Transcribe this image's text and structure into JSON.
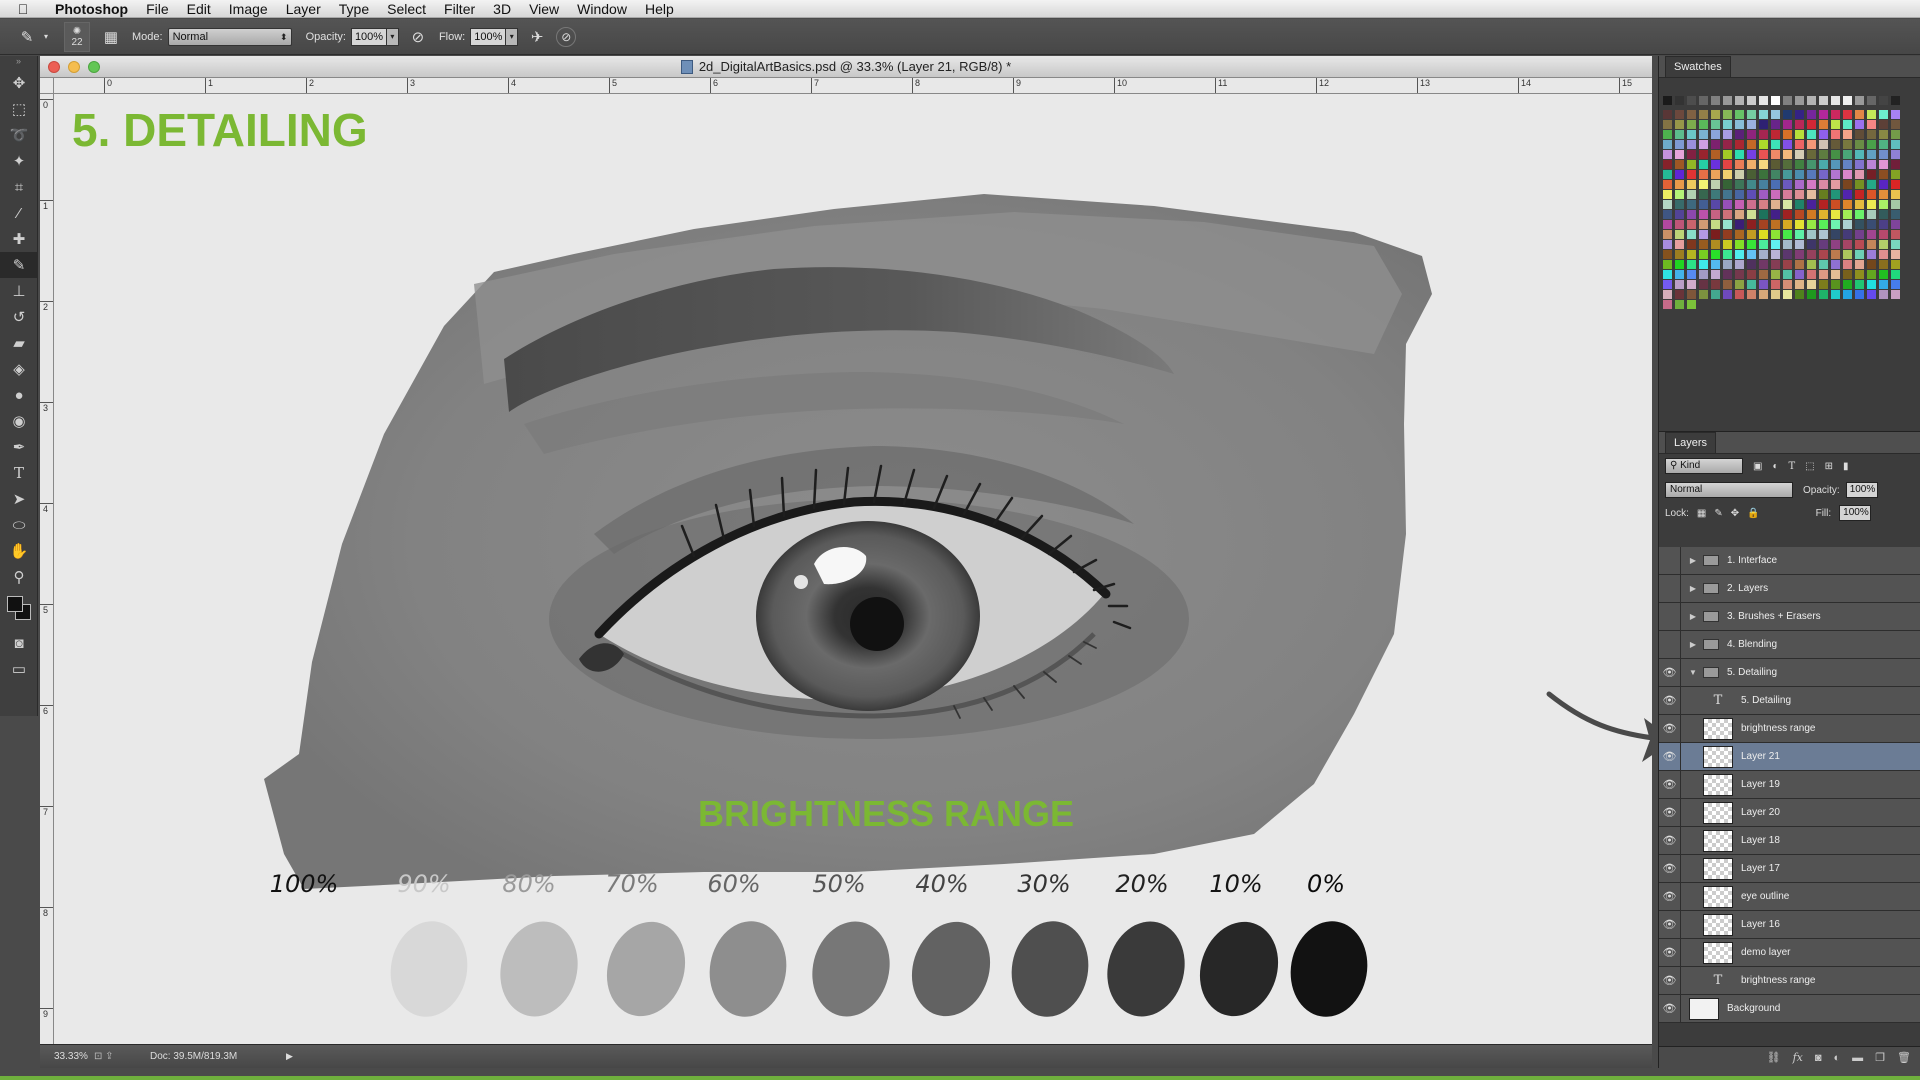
{
  "menubar": {
    "apple_icon": "apple-icon",
    "app_name": "Photoshop",
    "items": [
      "File",
      "Edit",
      "Image",
      "Layer",
      "Type",
      "Select",
      "Filter",
      "3D",
      "View",
      "Window",
      "Help"
    ]
  },
  "options_bar": {
    "brush_size": "22",
    "mode_label": "Mode:",
    "mode_value": "Normal",
    "opacity_label": "Opacity:",
    "opacity_value": "100%",
    "flow_label": "Flow:",
    "flow_value": "100%"
  },
  "document": {
    "title": "2d_DigitalArtBasics.psd @ 33.3% (Layer 21, RGB/8) *",
    "ruler_h": [
      "0",
      "1",
      "2",
      "3",
      "4",
      "5",
      "6",
      "7",
      "8",
      "9",
      "10",
      "11",
      "12",
      "13",
      "14",
      "15"
    ],
    "ruler_v": [
      "0",
      "1",
      "2",
      "3",
      "4",
      "5",
      "6",
      "7",
      "8",
      "9"
    ],
    "status": {
      "zoom": "33.33%",
      "doc_size": "Doc: 39.5M/819.3M"
    }
  },
  "artwork": {
    "heading": "5. DETAILING",
    "subheading": "BRIGHTNESS RANGE",
    "percent_labels": [
      "100%",
      "90%",
      "80%",
      "70%",
      "60%",
      "50%",
      "40%",
      "30%",
      "20%",
      "10%",
      "0%"
    ],
    "percent_label_colors": [
      "#111111",
      "#c8c8c8",
      "#9a9a9a",
      "#7a7a7a",
      "#666666",
      "#555555",
      "#444444",
      "#333333",
      "#222222",
      "#151515",
      "#0a0a0a"
    ],
    "swatch_colors": [
      "#d8d8d8",
      "#bdbdbd",
      "#a6a6a6",
      "#8e8e8e",
      "#777777",
      "#626262",
      "#4f4f4f",
      "#3a3a3a",
      "#272727",
      "#121212"
    ],
    "accent": "#7bb833"
  },
  "panels": {
    "swatches_title": "Swatches",
    "layers_title": "Layers",
    "filter_kind": "Kind",
    "blend_mode": "Normal",
    "opacity_label": "Opacity:",
    "opacity_value": "100%",
    "lock_label": "Lock:",
    "fill_label": "Fill:",
    "fill_value": "100%",
    "layers": [
      {
        "name": "1. Interface",
        "kind": "group",
        "visible": false,
        "expanded": false
      },
      {
        "name": "2. Layers",
        "kind": "group",
        "visible": false,
        "expanded": false
      },
      {
        "name": "3. Brushes + Erasers",
        "kind": "group",
        "visible": false,
        "expanded": false
      },
      {
        "name": "4. Blending",
        "kind": "group",
        "visible": false,
        "expanded": false
      },
      {
        "name": "5. Detailing",
        "kind": "group",
        "visible": true,
        "expanded": true
      },
      {
        "name": "5. Detailing",
        "kind": "text",
        "visible": true
      },
      {
        "name": "brightness range",
        "kind": "pixel",
        "visible": true
      },
      {
        "name": "Layer 21",
        "kind": "pixel",
        "visible": true,
        "selected": true
      },
      {
        "name": "Layer 19",
        "kind": "pixel",
        "visible": true
      },
      {
        "name": "Layer 20",
        "kind": "pixel",
        "visible": true
      },
      {
        "name": "Layer 18",
        "kind": "pixel",
        "visible": true
      },
      {
        "name": "Layer 17",
        "kind": "pixel",
        "visible": true
      },
      {
        "name": "eye outline",
        "kind": "pixel",
        "visible": true
      },
      {
        "name": "Layer 16",
        "kind": "pixel",
        "visible": true
      },
      {
        "name": "demo layer",
        "kind": "pixel",
        "visible": true
      },
      {
        "name": "brightness range",
        "kind": "text",
        "visible": true
      },
      {
        "name": "Background",
        "kind": "background",
        "visible": true
      }
    ]
  }
}
